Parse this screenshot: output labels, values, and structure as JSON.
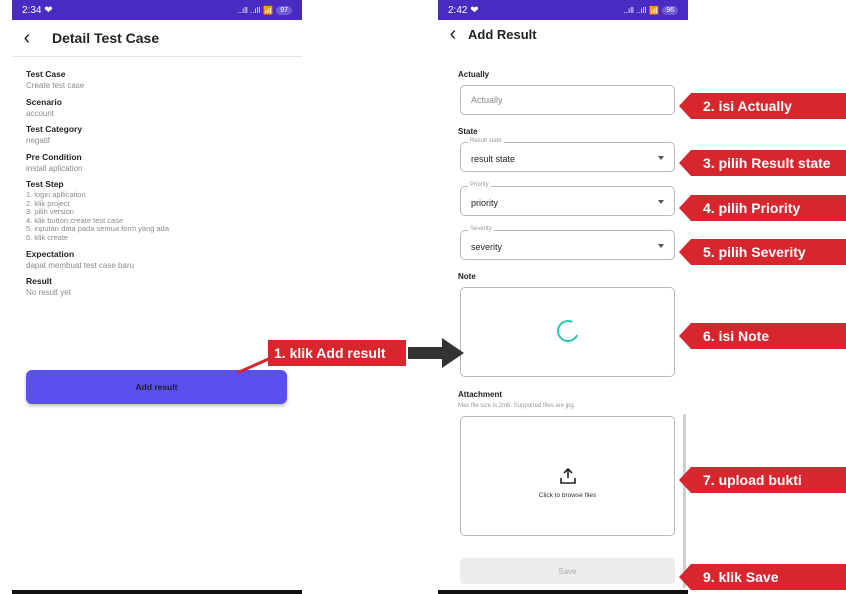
{
  "phone1": {
    "time": "2:34",
    "signal": "..ıll ..ıll",
    "battery": "97",
    "title": "Detail Test Case",
    "fields": [
      {
        "label": "Test Case",
        "value": "Create test case"
      },
      {
        "label": "Scenario",
        "value": "account"
      },
      {
        "label": "Test Category",
        "value": "negatif"
      },
      {
        "label": "Pre Condition",
        "value": "install aplication"
      }
    ],
    "test_step_label": "Test Step",
    "test_steps": [
      "1. login apllication",
      "2. klik project",
      "3. pilih version",
      "4. klik button create test case",
      "5. inputan data pada semua form yang ada",
      "6. klik create"
    ],
    "expectation_label": "Expectation",
    "expectation_value": "dapat membuat test case baru",
    "result_label": "Result",
    "result_value": "No result yet",
    "add_button": "Add result"
  },
  "phone2": {
    "time": "2:42",
    "signal": "..ıll ..ıll",
    "battery": "96",
    "title": "Add Result",
    "actually_label": "Actually",
    "actually_placeholder": "Actually",
    "state_label": "State",
    "result_state_legend": "Result state",
    "result_state_value": "result state",
    "priority_legend": "Priority",
    "priority_value": "priority",
    "severity_legend": "Severity",
    "severity_value": "severity",
    "note_label": "Note",
    "attachment_label": "Attachment",
    "attachment_hint": "Max file size is 2mb. Supported files are jpg",
    "browse_text": "Click to browse files",
    "save_button": "Save"
  },
  "annotations": {
    "a1": "1. klik Add result",
    "a2": "2. isi Actually",
    "a3": "3. pilih Result state",
    "a4": "4. pilih Priority",
    "a5": "5. pilih Severity",
    "a6": "6. isi Note",
    "a7": "7. upload bukti",
    "a9": "9. klik Save"
  },
  "colors": {
    "statusbar": "#4a2bc2",
    "primary_button": "#5a4ff0",
    "annotation_red": "#d8262e",
    "spinner": "#26c6b0"
  }
}
